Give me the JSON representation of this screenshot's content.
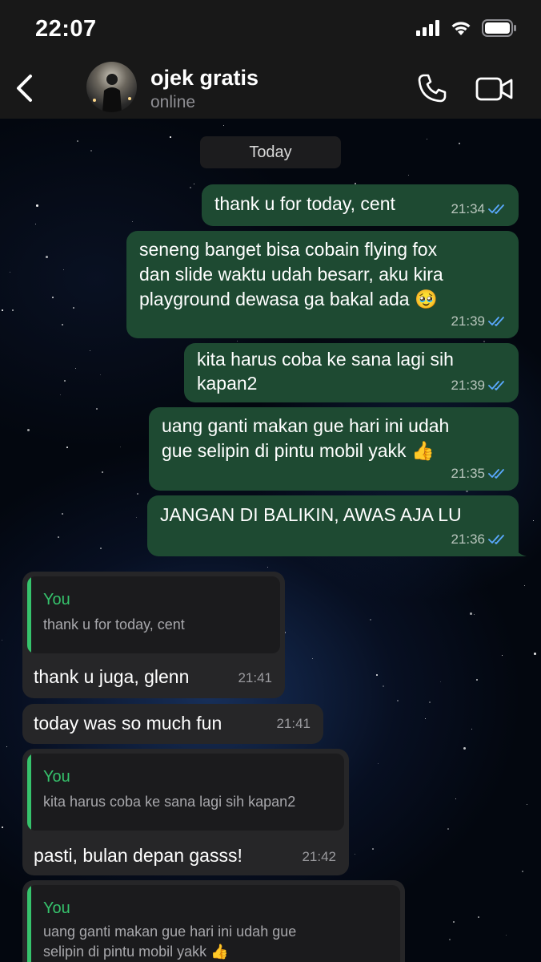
{
  "status_bar": {
    "time": "22:07"
  },
  "header": {
    "back_icon": "chevron-left-icon",
    "name": "ojek gratis",
    "status": "online"
  },
  "chat": {
    "date_label": "Today",
    "outgoing": [
      {
        "lines": [
          "thank u for today, cent"
        ],
        "time": "21:34"
      },
      {
        "lines": [
          "seneng banget bisa cobain flying fox",
          "dan slide waktu udah besarr, aku kira",
          "playground dewasa ga bakal ada 🥹"
        ],
        "time": "21:39"
      },
      {
        "lines": [
          "kita harus coba ke sana lagi sih",
          "kapan2"
        ],
        "time": "21:39"
      },
      {
        "lines": [
          "uang ganti makan gue hari ini udah",
          "gue selipin di pintu mobil yakk 👍"
        ],
        "time": "21:35"
      },
      {
        "lines": [
          "JANGAN DI BALIKIN, AWAS AJA LU"
        ],
        "time": "21:36"
      }
    ],
    "incoming": [
      {
        "reply_name": "You",
        "reply_lines": [
          "thank u for today, cent"
        ],
        "text": "thank u juga, glenn",
        "time": "21:41"
      },
      {
        "text": "today was so much fun",
        "time": "21:41"
      },
      {
        "reply_name": "You",
        "reply_lines": [
          "kita harus coba ke sana lagi sih kapan2"
        ],
        "text": "pasti, bulan depan gasss!",
        "time": "21:42"
      },
      {
        "reply_name": "You",
        "reply_lines": [
          "uang ganti makan gue hari ini udah gue",
          "selipin di pintu mobil yakk 👍"
        ]
      }
    ]
  },
  "colors": {
    "outgoing_bubble": "#1e4a32",
    "incoming_bubble": "#262628",
    "reply_accent": "#36c36c",
    "read_tick": "#5aa9ff"
  }
}
